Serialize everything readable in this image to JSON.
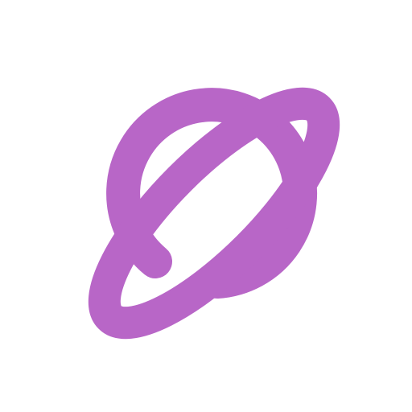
{
  "icon": {
    "name": "planet-icon",
    "stroke_color": "#B866C7",
    "background_color": "#FFFFFF"
  }
}
